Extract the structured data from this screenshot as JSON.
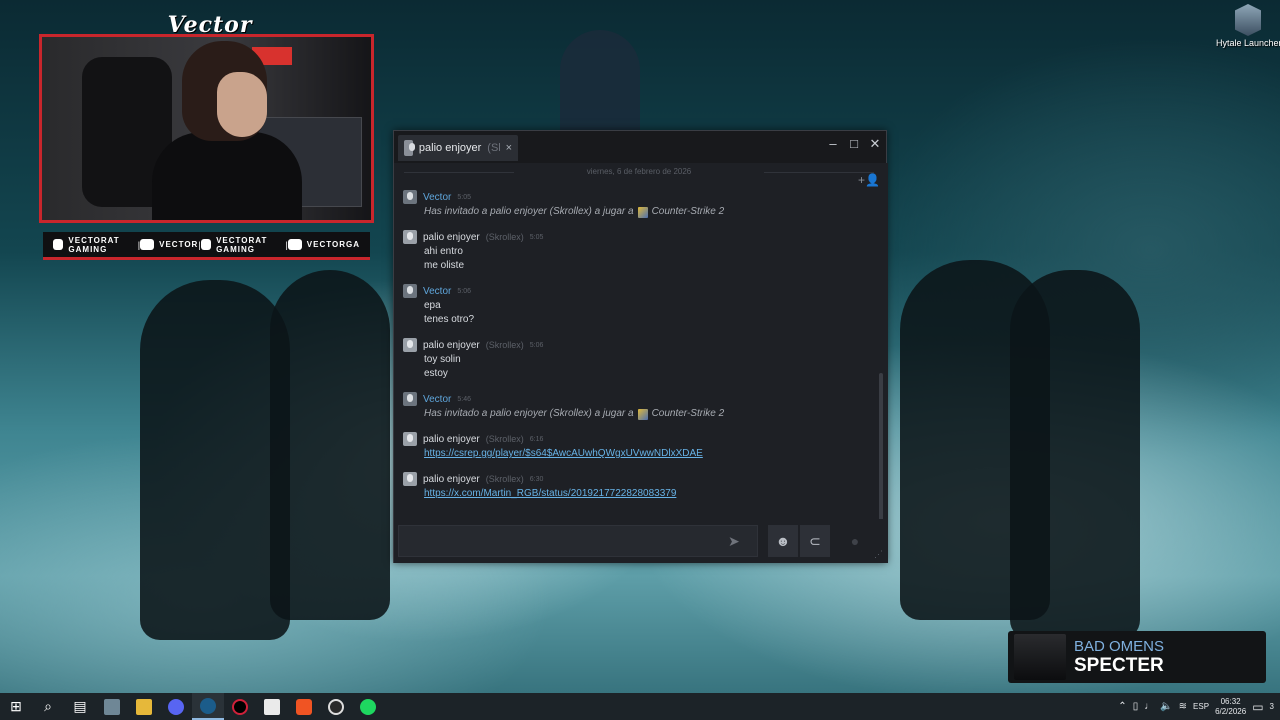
{
  "webcam": {
    "title": "Vector",
    "socials": [
      {
        "icon": "youtube-icon",
        "label": "VECTORAT GAMING"
      },
      {
        "icon": "twitch-icon",
        "label": "VECTOR"
      },
      {
        "icon": "twitter-icon",
        "label": "VECTORAT GAMING"
      },
      {
        "icon": "instagram-icon",
        "label": "VECTORGA"
      }
    ]
  },
  "desktop": {
    "icons": [
      {
        "label": "Hytale Launcher",
        "icon": "hytale-launcher-icon"
      }
    ]
  },
  "chat": {
    "tab": {
      "name": "palio enjoyer",
      "nick": "(Skrollex)",
      "close": "×"
    },
    "window_controls": {
      "minimize": "–",
      "maximize": "□",
      "close": "✕"
    },
    "date_divider": "viernes, 6 de febrero de 2026",
    "messages": [
      {
        "author": "Vector",
        "nick": "",
        "time": "5:05",
        "lines": [],
        "invite": {
          "text": "Has invitado a palio enjoyer (Skrollex) a jugar a",
          "game": "Counter-Strike 2"
        }
      },
      {
        "author": "palio enjoyer",
        "nick": "(Skrollex)",
        "time": "5:05",
        "lines": [
          "ahi entro",
          "me oliste"
        ]
      },
      {
        "author": "Vector",
        "nick": "",
        "time": "5:06",
        "lines": [
          "epa",
          "tenes otro?"
        ]
      },
      {
        "author": "palio enjoyer",
        "nick": "(Skrollex)",
        "time": "5:06",
        "lines": [
          "toy solin",
          "estoy"
        ]
      },
      {
        "author": "Vector",
        "nick": "",
        "time": "5:46",
        "lines": [],
        "invite": {
          "text": "Has invitado a palio enjoyer (Skrollex) a jugar a",
          "game": "Counter-Strike 2"
        }
      },
      {
        "author": "palio enjoyer",
        "nick": "(Skrollex)",
        "time": "6:16",
        "link": "https://csrep.gg/player/$s64$AwcAUwhQWgxUVwwNDlxXDAE"
      },
      {
        "author": "palio enjoyer",
        "nick": "(Skrollex)",
        "time": "6:30",
        "link": "https://x.com/Martin_RGB/status/2019217722828083379"
      }
    ],
    "input": {
      "placeholder": "",
      "send_icon": "send-icon",
      "emoji_icon": "emoji-icon",
      "attach_icon": "paperclip-icon",
      "voice_icon": "microphone-icon"
    }
  },
  "now_playing": {
    "artist": "BAD OMENS",
    "song": "SPECTER"
  },
  "taskbar": {
    "apps": [
      "start-icon",
      "search-icon",
      "task-view-icon",
      "file-explorer-icon",
      "folder-icon",
      "discord-icon",
      "steam-icon",
      "opera-gx-icon",
      "epic-games-icon",
      "brave-icon",
      "obs-icon",
      "spotify-icon"
    ],
    "tray": {
      "lang": "ESP",
      "time": "06:32",
      "date": "6/2/2026",
      "notifications": "3"
    }
  },
  "colors": {
    "accent_red": "#c9262c",
    "vector_name": "#5fa6dc",
    "link": "#67b2e6",
    "artist": "#7fb0df"
  }
}
